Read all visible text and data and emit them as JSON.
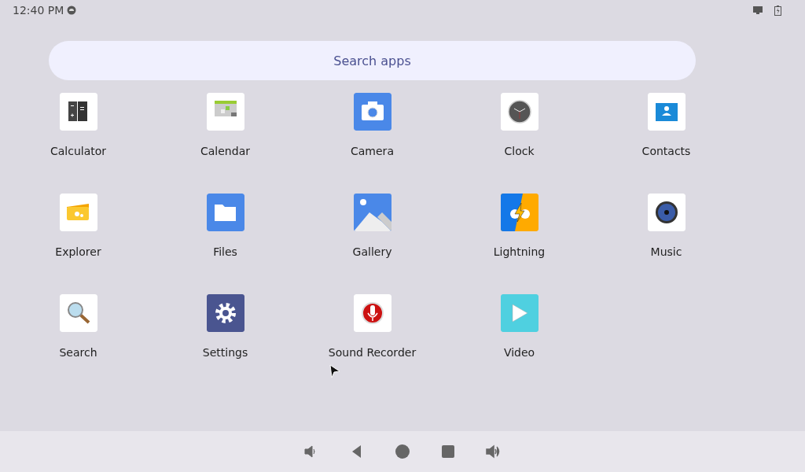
{
  "status_bar": {
    "time": "12:40 PM"
  },
  "search": {
    "placeholder": "Search apps"
  },
  "apps": [
    {
      "label": "Calculator",
      "kind": "calculator"
    },
    {
      "label": "Calendar",
      "kind": "calendar"
    },
    {
      "label": "Camera",
      "kind": "camera"
    },
    {
      "label": "Clock",
      "kind": "clock"
    },
    {
      "label": "Contacts",
      "kind": "contacts"
    },
    {
      "label": "Explorer",
      "kind": "explorer"
    },
    {
      "label": "Files",
      "kind": "files"
    },
    {
      "label": "Gallery",
      "kind": "gallery"
    },
    {
      "label": "Lightning",
      "kind": "lightning"
    },
    {
      "label": "Music",
      "kind": "music"
    },
    {
      "label": "Search",
      "kind": "search"
    },
    {
      "label": "Settings",
      "kind": "settings"
    },
    {
      "label": "Sound Recorder",
      "kind": "recorder"
    },
    {
      "label": "Video",
      "kind": "video"
    }
  ],
  "nav_bar": [
    {
      "kind": "volume-down"
    },
    {
      "kind": "back"
    },
    {
      "kind": "home"
    },
    {
      "kind": "recents"
    },
    {
      "kind": "volume-up"
    }
  ]
}
